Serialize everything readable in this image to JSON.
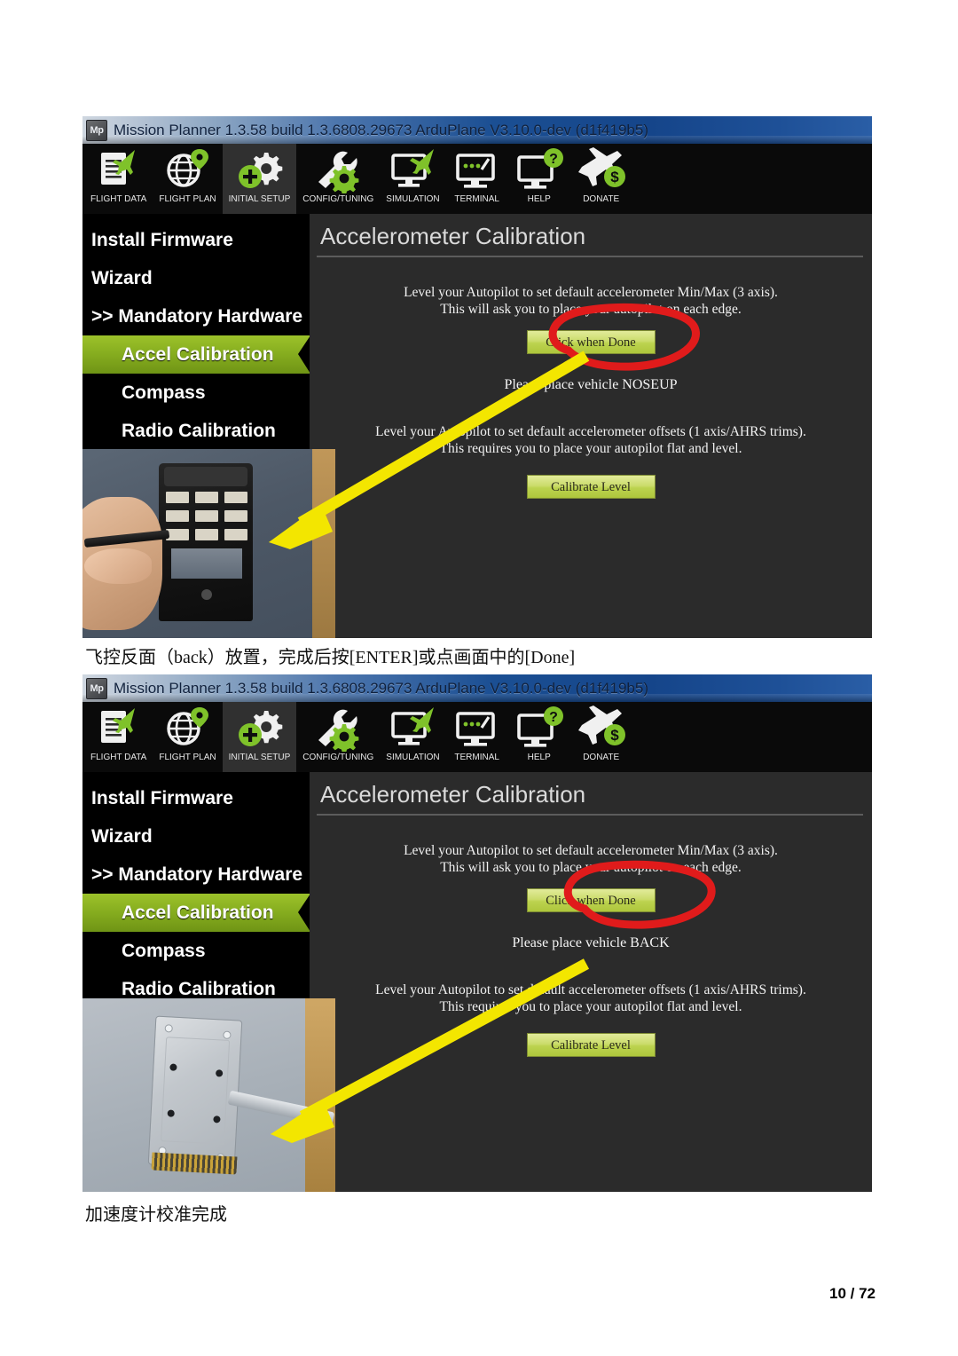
{
  "document": {
    "caption_middle": "飞控反面（back）放置，完成后按[ENTER]或点画面中的[Done]",
    "caption_bottom": "加速度计校准完成",
    "page_number": "10 / 72"
  },
  "colors": {
    "accent_green": "#8ab520",
    "button_green": "#c3d45e",
    "annotation_red": "#e01b1b",
    "arrow_yellow": "#f3e600",
    "panel_bg": "#2b2b2b",
    "sidebar_bg": "#000000",
    "titlebar_blue": "#1b4f93"
  },
  "window": {
    "title": "Mission Planner 1.3.58 build 1.3.6808.29673 ArduPlane V3.10.0-dev (d1f419b5)",
    "logo_label": "Mp"
  },
  "toolbar": {
    "items": [
      {
        "label": "FLIGHT DATA",
        "icon": "document-plane-icon",
        "active": false
      },
      {
        "label": "FLIGHT PLAN",
        "icon": "globe-pin-icon",
        "active": false
      },
      {
        "label": "INITIAL SETUP",
        "icon": "gear-plus-icon",
        "active": true
      },
      {
        "label": "CONFIG/TUNING",
        "icon": "wrench-gear-icon",
        "active": false
      },
      {
        "label": "SIMULATION",
        "icon": "monitor-plane-icon",
        "active": false
      },
      {
        "label": "TERMINAL",
        "icon": "monitor-dots-icon",
        "active": false
      },
      {
        "label": "HELP",
        "icon": "monitor-question-icon",
        "active": false
      },
      {
        "label": "DONATE",
        "icon": "plane-dollar-icon",
        "active": false
      }
    ]
  },
  "sidebar": {
    "items": [
      {
        "label": "Install Firmware",
        "selected": false,
        "indent": false
      },
      {
        "label": "Wizard",
        "selected": false,
        "indent": false
      },
      {
        "label": ">> Mandatory Hardware",
        "selected": false,
        "indent": false
      },
      {
        "label": "Accel Calibration",
        "selected": true,
        "indent": true
      },
      {
        "label": "Compass",
        "selected": false,
        "indent": true
      },
      {
        "label": "Radio Calibration",
        "selected": true,
        "indent": true
      }
    ]
  },
  "panel": {
    "title": "Accelerometer Calibration",
    "paragraph1_line1": "Level your Autopilot to set default accelerometer Min/Max (3 axis).",
    "paragraph1_line2": "This will ask you to place your autopilot on each edge.",
    "done_button": "Click when Done",
    "paragraph2_line1": "Level your Autopilot to set default accelerometer offsets (1 axis/AHRS trims).",
    "paragraph2_line2": "This requires you to place your autopilot flat and level.",
    "level_button": "Calibrate Level"
  },
  "screenshots": [
    {
      "id": "screenshot-noseup",
      "place_message": "Please place vehicle NOSEUP",
      "annotation": "red-circle-around-noseup",
      "photo": "hand-holding-black-handheld-device"
    },
    {
      "id": "screenshot-back",
      "place_message": "Please place vehicle BACK",
      "annotation": "red-circle-around-back",
      "photo": "silver-flight-controller-case-on-desk"
    }
  ]
}
